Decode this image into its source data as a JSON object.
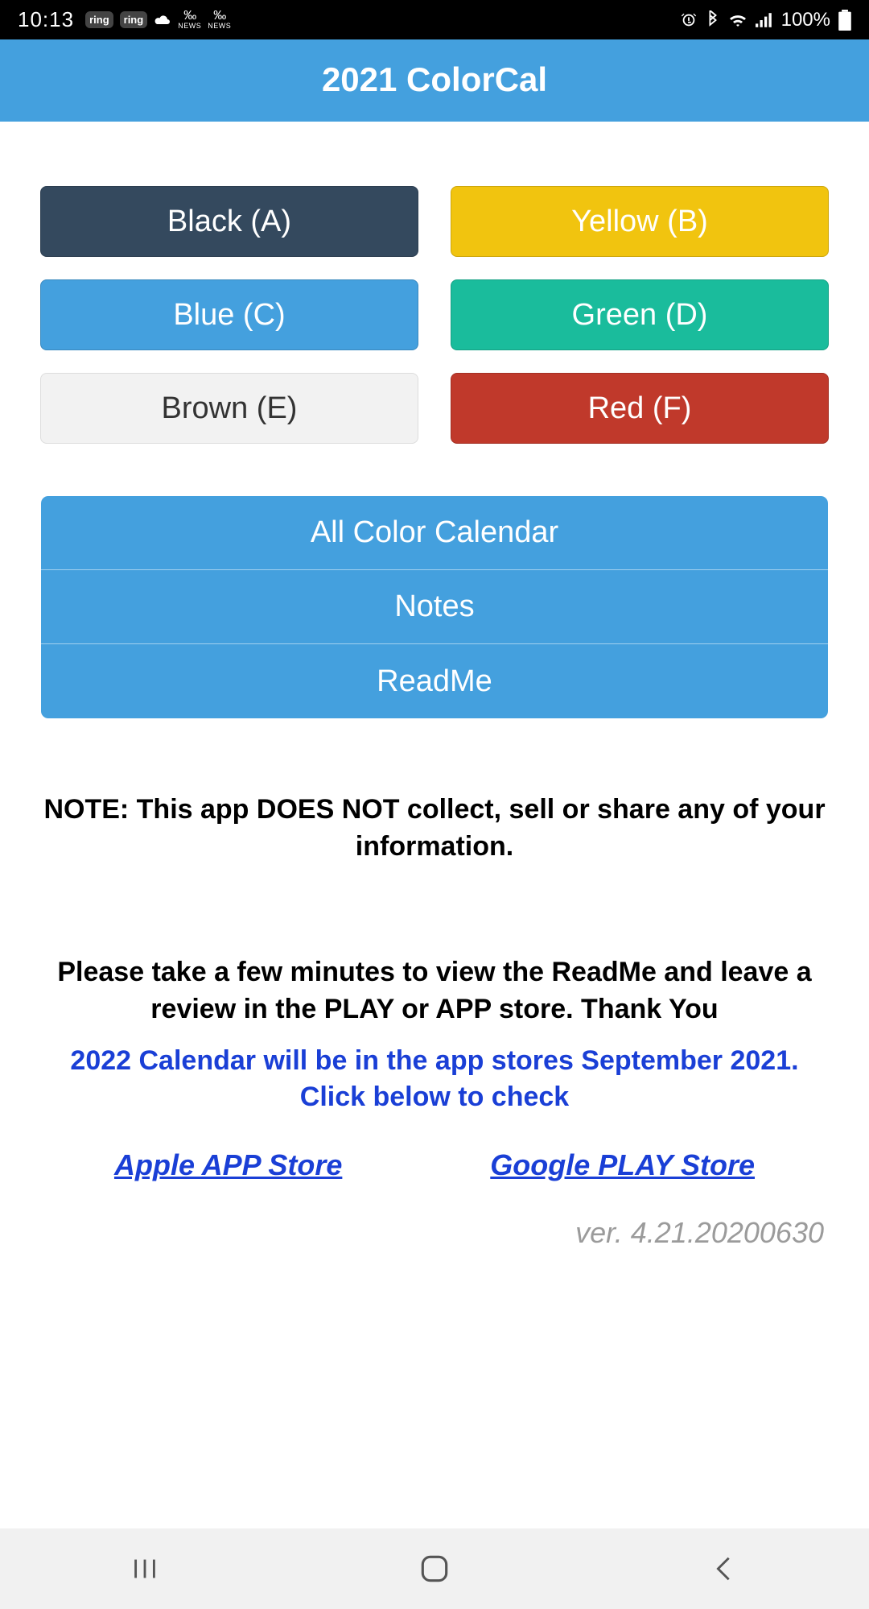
{
  "statusbar": {
    "time": "10:13",
    "tray": {
      "ring1": "ring",
      "ring2": "ring",
      "news1_top": "‰",
      "news1_bot": "NEWS",
      "news2_top": "‰",
      "news2_bot": "NEWS"
    },
    "battery_pct": "100%"
  },
  "header": {
    "title": "2021 ColorCal"
  },
  "colors": {
    "blackA": "Black (A)",
    "yellowB": "Yellow (B)",
    "blueC": "Blue (C)",
    "greenD": "Green (D)",
    "brownE": "Brown (E)",
    "redF": "Red (F)"
  },
  "menu": {
    "all": "All Color Calendar",
    "notes": "Notes",
    "readme": "ReadMe"
  },
  "notes": {
    "privacy": "NOTE: This app DOES NOT collect, sell or share any of your information.",
    "review": "Please take a few minutes to view the ReadMe and leave a review in the PLAY or APP store. Thank You",
    "upcoming": "2022 Calendar will be in the app stores September 2021. Click below to check"
  },
  "links": {
    "apple": "Apple APP Store",
    "google": "Google PLAY Store"
  },
  "version": "ver. 4.21.20200630"
}
